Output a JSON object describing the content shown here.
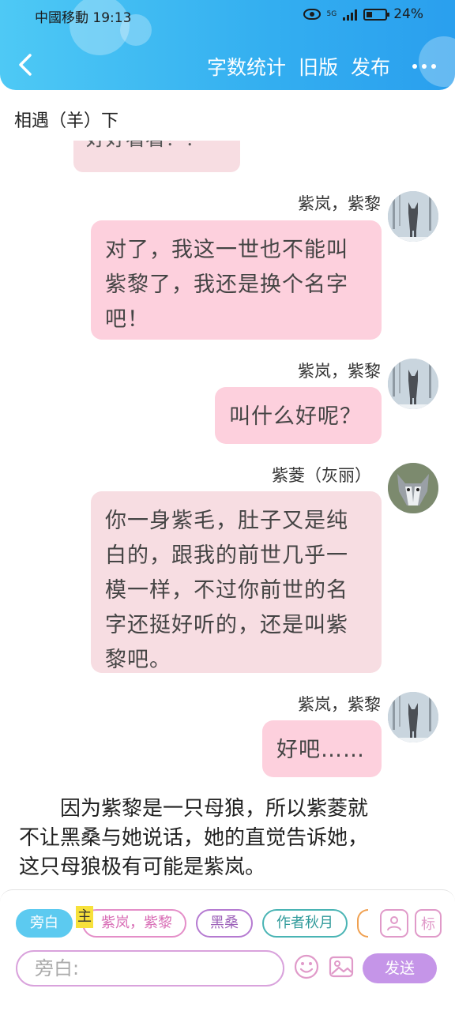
{
  "status_bar": {
    "carrier": "中國移動",
    "time": "19:13",
    "network": "5G",
    "battery": "24%"
  },
  "header": {
    "actions": [
      "字数统计",
      "旧版",
      "发布"
    ]
  },
  "chapter_title": "相遇（羊）下",
  "partial_message": "好好看看！！",
  "messages": [
    {
      "speaker": "紫岚，紫黎",
      "text": "对了，我这一世也不能叫紫黎了，我还是换个名字吧！",
      "lines": [
        "对了，我这一世也不能叫",
        "紫黎了，我还是换个名字",
        "吧！"
      ]
    },
    {
      "speaker": "紫岚，紫黎",
      "text": "叫什么好呢？",
      "lines": [
        "叫什么好呢？"
      ]
    },
    {
      "speaker": "紫菱（灰丽）",
      "text": "你一身紫毛，肚子又是纯白的，跟我的前世几乎一模一样，不过你前世的名字还挺好听的，还是叫紫黎吧。",
      "lines": [
        "你一身紫毛，肚子又是纯",
        "白的，跟我的前世几乎一",
        "模一样，不过你前世的名",
        "字还挺好听的，还是叫紫",
        "黎吧。"
      ]
    },
    {
      "speaker": "紫岚，紫黎",
      "text": "好吧……",
      "lines": [
        "好吧……"
      ]
    }
  ],
  "narration": "因为紫黎是一只母狼，所以紫菱就不让黑桑与她说话，她的直觉告诉她，这只母狼极有可能是紫岚。",
  "narration_lines": [
    "　　因为紫黎是一只母狼，所以紫菱就",
    "不让黑桑与她说话，她的直觉告诉她，",
    "这只母狼极有可能是紫岚。"
  ],
  "input_panel": {
    "chips": {
      "narration": "旁白",
      "main_tag": "主",
      "main_role": "紫岚，紫黎",
      "role_2": "黑桑",
      "role_3": "作者秋月"
    },
    "tag_button": "标",
    "placeholder": "旁白:",
    "send_label": "发送"
  },
  "colors": {
    "header_gradient": [
      "#4ec9f5",
      "#2a9fee"
    ],
    "bubble_self": "#fdd0dd",
    "bubble_other": "#f7dde2",
    "send_button": "#c595e8"
  },
  "icons": [
    "back-chevron-icon",
    "more-dots-icon",
    "eye-icon",
    "signal-icon",
    "battery-icon",
    "person-icon",
    "emoji-icon",
    "image-icon"
  ]
}
